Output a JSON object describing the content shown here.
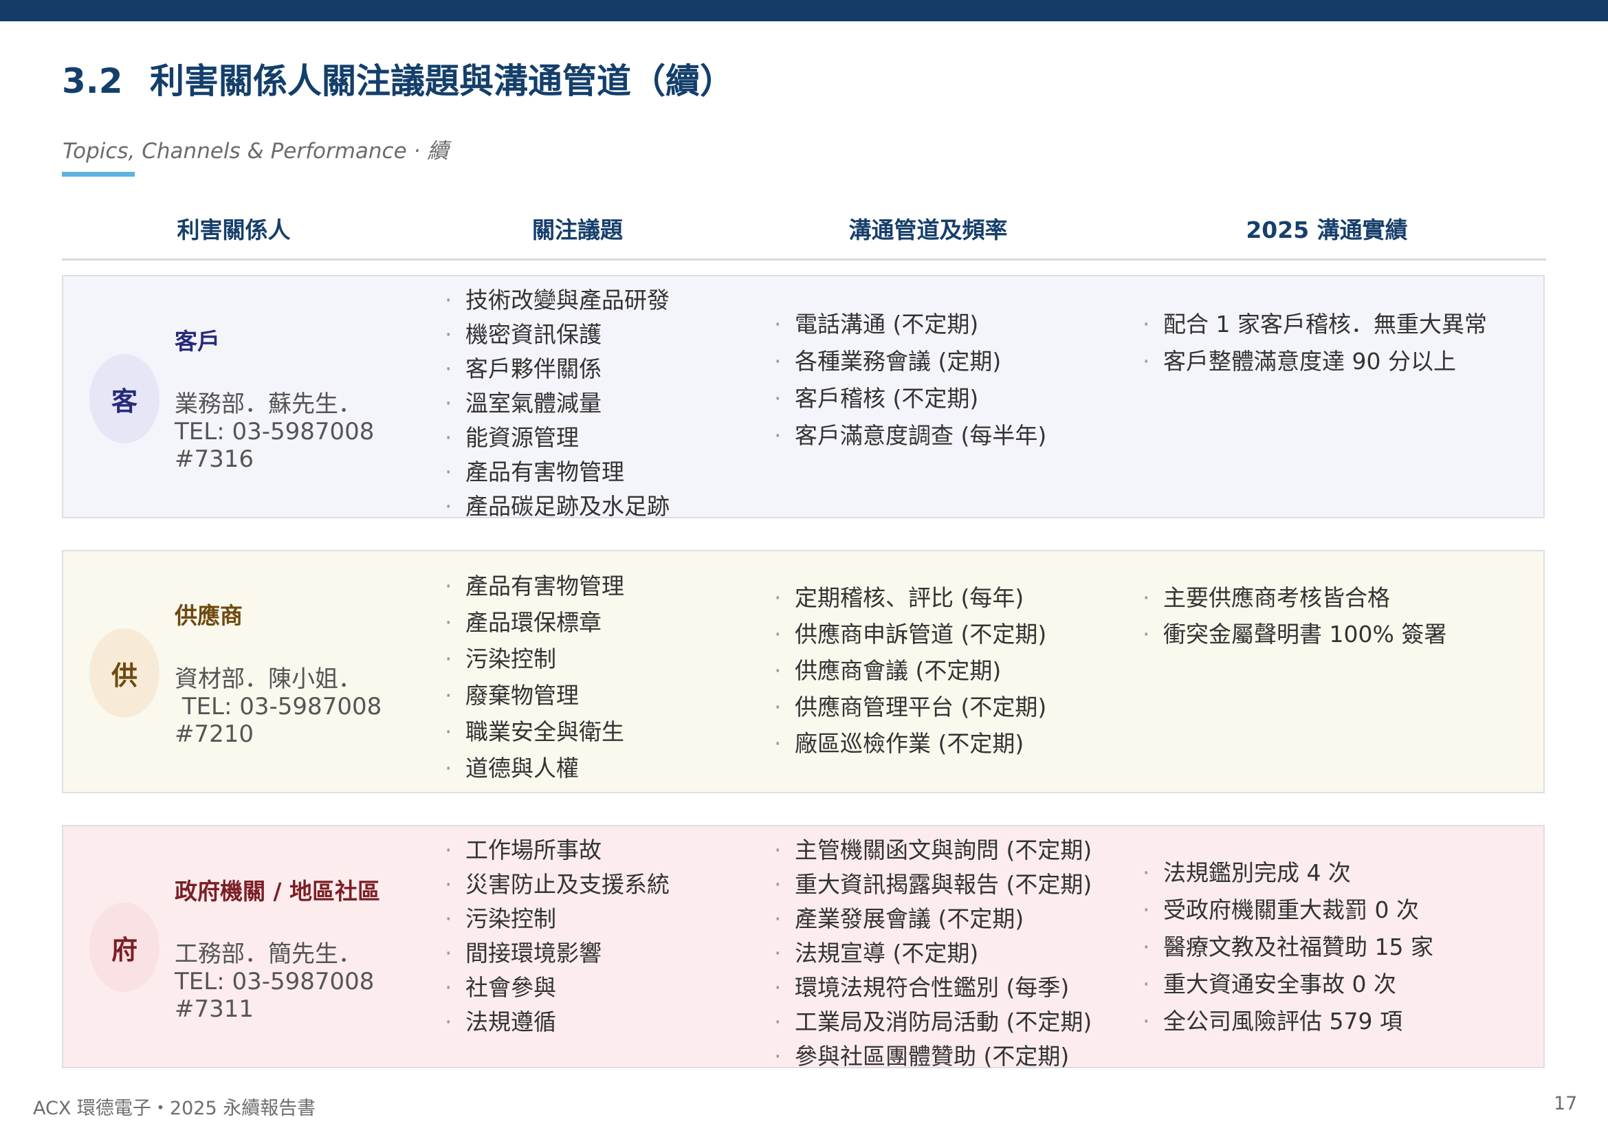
{
  "header": {
    "section_number": "3.2",
    "title": "利害關係人關注議題與溝通管道（續）",
    "subtitle": "Topics, Channels & Performance · 續"
  },
  "table": {
    "columns": [
      "利害關係人",
      "關注議題",
      "溝通管道及頻率",
      "2025 溝通實績"
    ],
    "rows": [
      {
        "badge": "客",
        "name": "客戶",
        "contact": "業務部．蘇先生．\nTEL: 03-5987008\n#7316",
        "colors": {
          "bg": "#f4f4fb",
          "circle": "#e6e6f7",
          "accent": "#262b7a"
        },
        "topics": [
          "技術改變與產品研發",
          "機密資訊保護",
          "客戶夥伴關係",
          "溫室氣體減量",
          "能資源管理",
          "產品有害物管理",
          "產品碳足跡及水足跡"
        ],
        "channels": [
          "電話溝通 (不定期)",
          "各種業務會議 (定期)",
          "客戶稽核 (不定期)",
          "客戶滿意度調查 (每半年)"
        ],
        "results": [
          "配合 1 家客戶稽核．無重大異常",
          "客戶整體滿意度達 90 分以上"
        ]
      },
      {
        "badge": "供",
        "name": "供應商",
        "contact": "資材部．陳小姐．\n TEL: 03-5987008\n#7210",
        "colors": {
          "bg": "#fbf8ee",
          "circle": "#f7ebd8",
          "accent": "#6e4a10"
        },
        "topics": [
          "產品有害物管理",
          "產品環保標章",
          "污染控制",
          "廢棄物管理",
          "職業安全與衛生",
          "道德與人權"
        ],
        "channels": [
          "定期稽核、評比 (每年)",
          "供應商申訴管道 (不定期)",
          "供應商會議 (不定期)",
          "供應商管理平台 (不定期)",
          "廠區巡檢作業 (不定期)"
        ],
        "results": [
          "主要供應商考核皆合格",
          "衝突金屬聲明書 100% 簽署"
        ]
      },
      {
        "badge": "府",
        "name": "政府機關 / 地區社區",
        "contact": "工務部．簡先生．\nTEL: 03-5987008\n#7311",
        "colors": {
          "bg": "#fcecee",
          "circle": "#f9e1e4",
          "accent": "#7a1f24"
        },
        "topics": [
          "工作場所事故",
          "災害防止及支援系統",
          "污染控制",
          "間接環境影響",
          "社會參與",
          "法規遵循"
        ],
        "channels": [
          "主管機關函文與詢問 (不定期)",
          "重大資訊揭露與報告 (不定期)",
          "產業發展會議 (不定期)",
          "法規宣導 (不定期)",
          "環境法規符合性鑑別 (每季)",
          "工業局及消防局活動 (不定期)",
          "參與社區團體贊助 (不定期)"
        ],
        "results": [
          "法規鑑別完成 4 次",
          "受政府機關重大裁罰 0 次",
          "醫療文教及社福贊助 15 家",
          "重大資通安全事故 0 次",
          "全公司風險評估 579 項"
        ]
      }
    ]
  },
  "footer": {
    "left": "ACX 環德電子・2025 永續報告書",
    "page_number": "17"
  }
}
